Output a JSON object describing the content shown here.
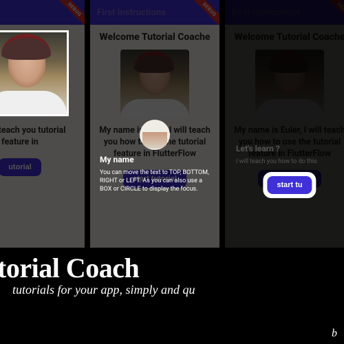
{
  "debug_label": "DEBUG",
  "topbar_title": "First Instructions",
  "welcome_heading": "Welcome Tutorial Coache",
  "intro_text": "My name is Euler, I will teach you how to use the tutorial feature in FlutterFlow",
  "button_label": "start tutorial",
  "screen1": {
    "visible_heading_fragment": "torial Coache",
    "visible_intro_fragment": ", I will teach you tutorial feature in",
    "visible_button_fragment": "utorial"
  },
  "screen2": {
    "coach_title": "My name",
    "coach_body": "You can move the text to TOP, BOTTOM, RIGHT or LEFT. As you can also use a BOX or CIRCLE to display the focus."
  },
  "screen3": {
    "coach_title": "Let's learn ?",
    "coach_body": "I will teach you how to do this",
    "visible_button_fragment": "start tu"
  },
  "marketing": {
    "title_fragment": "torial Coach",
    "subtitle_fragment": "tutorials for your app, simply and qu",
    "byline_fragment": "b"
  }
}
